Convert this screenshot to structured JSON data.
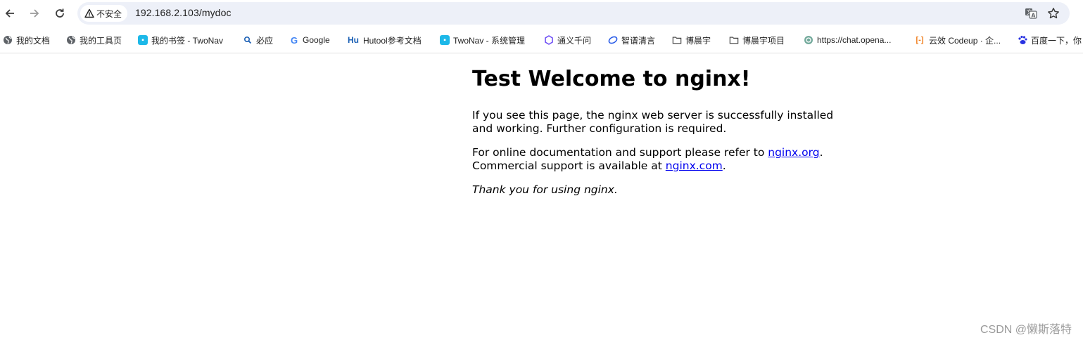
{
  "browser": {
    "security_label": "不安全",
    "url": "192.168.2.103/mydoc"
  },
  "bookmarks": [
    {
      "label": "我的文档",
      "icon": "globe-icon"
    },
    {
      "label": "我的工具页",
      "icon": "globe-icon"
    },
    {
      "label": "我的书签 - TwoNav",
      "icon": "twonav-icon"
    },
    {
      "label": "必应",
      "icon": "search-icon"
    },
    {
      "label": "Google",
      "icon": "google-icon"
    },
    {
      "label": "Hutool参考文档",
      "icon": "hutool-icon"
    },
    {
      "label": "TwoNav - 系统管理",
      "icon": "twonav-icon"
    },
    {
      "label": "通义千问",
      "icon": "tongyi-icon"
    },
    {
      "label": "智谱清言",
      "icon": "zhipu-icon"
    },
    {
      "label": "博晨宇",
      "icon": "folder-icon"
    },
    {
      "label": "博晨宇项目",
      "icon": "folder-icon"
    },
    {
      "label": "https://chat.opena...",
      "icon": "openai-icon"
    },
    {
      "label": "云效 Codeup · 企...",
      "icon": "codeup-icon"
    },
    {
      "label": "百度一下，你",
      "icon": "baidu-icon"
    }
  ],
  "page": {
    "heading": "Test Welcome to nginx!",
    "para1": "If you see this page, the nginx web server is successfully installed and working. Further configuration is required.",
    "para2_prefix": "For online documentation and support please refer to ",
    "link1": "nginx.org",
    "para2_mid": ".",
    "para2_line2": "Commercial support is available at ",
    "link2": "nginx.com",
    "para2_end": ".",
    "thanks": "Thank you for using nginx."
  },
  "watermark": "CSDN @懒斯落特",
  "colors": {
    "omnibox_bg": "#edf0f8",
    "link": "#0000ee",
    "twonav": "#1db8e8",
    "hutool": "#1a5fb4",
    "codeup": "#f07c1a",
    "baidu": "#2932e1"
  }
}
